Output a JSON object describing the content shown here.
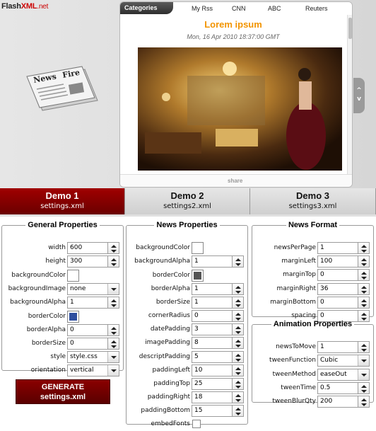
{
  "brand": {
    "name_a": "Flash",
    "name_b": "XML",
    "name_c": ".net"
  },
  "viewer": {
    "categories_label": "Categories",
    "tabs": [
      "My Rss",
      "CNN",
      "ABC",
      "Reuters"
    ],
    "headline": "Lorem ipsum",
    "date": "Mon, 16 Apr 2010 18:37:00 GMT",
    "share": "share",
    "nav_up": "^",
    "nav_down": "v"
  },
  "demos": [
    {
      "title": "Demo 1",
      "file": "settings.xml",
      "active": true
    },
    {
      "title": "Demo 2",
      "file": "settings2.xml",
      "active": false
    },
    {
      "title": "Demo 3",
      "file": "settings3.xml",
      "active": false
    }
  ],
  "general": {
    "legend": "General Properties",
    "width_label": "width",
    "width": "600",
    "height_label": "height",
    "height": "300",
    "bgcolor_label": "backgroundColor",
    "bgimage_label": "backgroundImage",
    "bgimage": "none",
    "bgalpha_label": "backgroundAlpha",
    "bgalpha": "1",
    "bordercolor_label": "borderColor",
    "borderalpha_label": "borderAlpha",
    "borderalpha": "0",
    "bordersize_label": "borderSize",
    "bordersize": "0",
    "style_label": "style",
    "style": "style.css",
    "orientation_label": "orientation",
    "orientation": "vertical"
  },
  "newsprops": {
    "legend": "News Properties",
    "bgcolor_label": "backgroundColor",
    "bgalpha_label": "backgroundAlpha",
    "bgalpha": "1",
    "bordercolor_label": "borderColor",
    "borderalpha_label": "borderAlpha",
    "borderalpha": "1",
    "bordersize_label": "borderSize",
    "bordersize": "1",
    "cornerradius_label": "cornerRadius",
    "cornerradius": "0",
    "datepadding_label": "datePadding",
    "datepadding": "3",
    "imagepadding_label": "imagePadding",
    "imagepadding": "8",
    "descriptpadding_label": "descriptPadding",
    "descriptpadding": "5",
    "paddingleft_label": "paddingLeft",
    "paddingleft": "10",
    "paddingtop_label": "paddingTop",
    "paddingtop": "25",
    "paddingright_label": "paddingRight",
    "paddingright": "18",
    "paddingbottom_label": "paddingBottom",
    "paddingbottom": "15",
    "embedfonts_label": "embedFonts"
  },
  "newsformat": {
    "legend": "News Format",
    "newsperpage_label": "newsPerPage",
    "newsperpage": "1",
    "marginleft_label": "marginLeft",
    "marginleft": "100",
    "margintop_label": "marginTop",
    "margintop": "0",
    "marginright_label": "marginRight",
    "marginright": "36",
    "marginbottom_label": "marginBottom",
    "marginbottom": "0",
    "spacing_label": "spacing",
    "spacing": "0"
  },
  "animation": {
    "legend": "Animation Properties",
    "newstomove_label": "newsToMove",
    "newstomove": "1",
    "tweenfunction_label": "tweenFunction",
    "tweenfunction": "Cubic",
    "tweenmethod_label": "tweenMethod",
    "tweenmethod": "easeOut",
    "tweentime_label": "tweenTime",
    "tweentime": "0.5",
    "tweenblurqty_label": "tweenBlurQty",
    "tweenblurqty": "200"
  },
  "generate": {
    "line1": "GENERATE",
    "line2": "settings.xml"
  },
  "colors": {
    "accent": "#a00000",
    "headline": "#f29400",
    "general_border_swatch": "#2f4f9f",
    "news_border_swatch": "#555555"
  }
}
